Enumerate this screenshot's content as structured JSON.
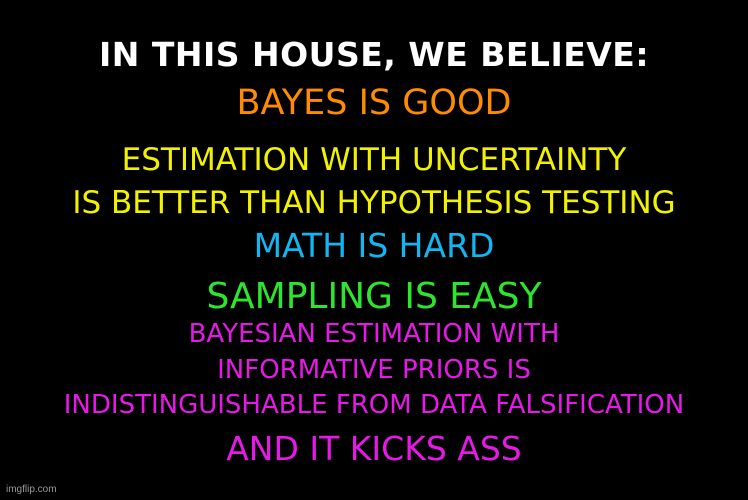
{
  "header": "IN THIS HOUSE, WE BELIEVE:",
  "lines": [
    {
      "text": "BAYES IS GOOD",
      "color": "#ff8c00"
    },
    {
      "text": "ESTIMATION WITH UNCERTAINTY",
      "color": "#f2f200"
    },
    {
      "text": "IS BETTER THAN HYPOTHESIS TESTING",
      "color": "#f2f200"
    },
    {
      "text": "MATH IS HARD",
      "color": "#12b6f0"
    },
    {
      "text": "SAMPLING IS EASY",
      "color": "#2ee52e"
    },
    {
      "text": "BAYESIAN ESTIMATION WITH",
      "color": "#e619e6"
    },
    {
      "text": "INFORMATIVE PRIORS IS",
      "color": "#e619e6"
    },
    {
      "text": "INDISTINGUISHABLE FROM DATA FALSIFICATION",
      "color": "#e619e6"
    },
    {
      "text": "AND IT KICKS ASS",
      "color": "#e619e6"
    }
  ],
  "watermark": "imgflip.com"
}
